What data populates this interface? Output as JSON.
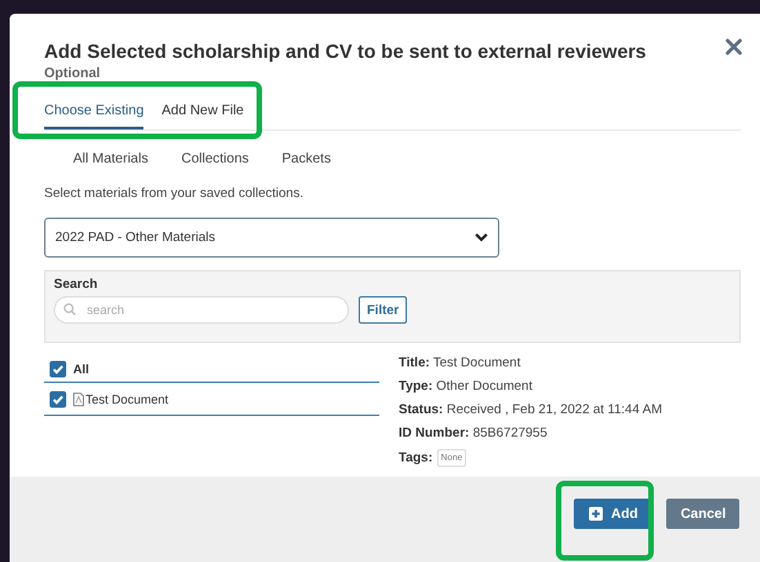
{
  "dialog": {
    "title": "Add Selected scholarship and CV to be sent to external reviewers",
    "subtitle": "Optional"
  },
  "tabs": {
    "highlighted": true,
    "items": [
      {
        "label": "Choose Existing",
        "selected": true
      },
      {
        "label": "Add New File",
        "selected": false
      }
    ]
  },
  "subtabs": [
    {
      "label": "All Materials"
    },
    {
      "label": "Collections"
    },
    {
      "label": "Packets"
    }
  ],
  "instruction": "Select materials from your saved collections.",
  "collection_select": {
    "value": "2022 PAD - Other Materials"
  },
  "search": {
    "label": "Search",
    "placeholder": "search",
    "button": "Filter"
  },
  "materials": {
    "all": {
      "label": "All",
      "checked": true
    },
    "items": [
      {
        "label": "Test Document",
        "checked": true
      }
    ]
  },
  "details": [
    {
      "label": "Title:",
      "value": "Test Document"
    },
    {
      "label": "Type:",
      "value": "Other Document"
    },
    {
      "label": "Status:",
      "value": "Received , Feb 21, 2022 at 11:44 AM"
    },
    {
      "label": "ID Number:",
      "value": "85B6727955"
    }
  ],
  "tags": {
    "label": "Tags:",
    "values": [
      "None"
    ]
  },
  "buttons": [
    {
      "kind": "primary",
      "label": "Add",
      "highlighted": true
    },
    {
      "kind": "secondary",
      "label": "Cancel",
      "highlighted": false
    }
  ]
}
